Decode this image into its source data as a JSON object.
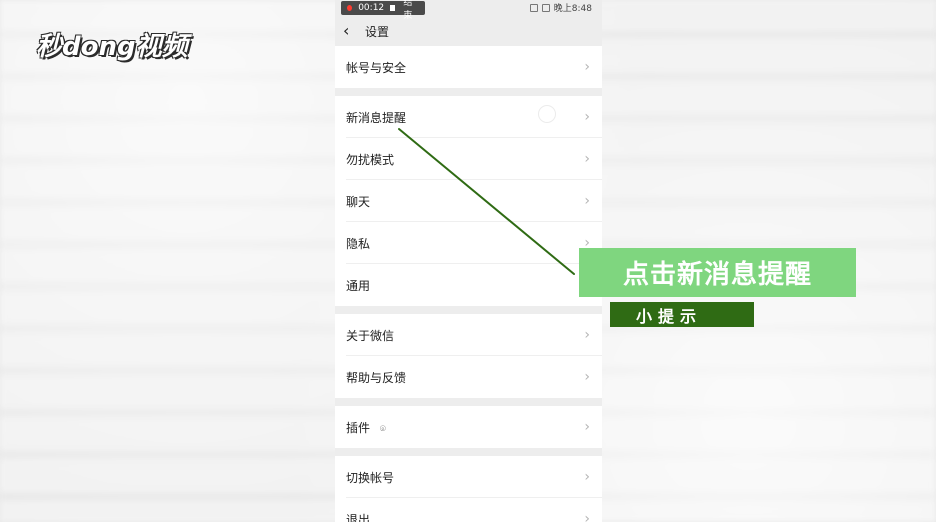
{
  "watermark": {
    "logo_text": "秒dong视频"
  },
  "status_bar": {
    "recording_time": "00:12",
    "recording_end": "结束",
    "clock_text": "晚上8:48",
    "icons": [
      "vibrate-icon",
      "battery-icon"
    ]
  },
  "navbar": {
    "back_icon": "chevron-left-icon",
    "title": "设置"
  },
  "settings": {
    "groups": [
      {
        "items": [
          {
            "label": "帐号与安全"
          }
        ]
      },
      {
        "items": [
          {
            "label": "新消息提醒"
          },
          {
            "label": "勿扰模式"
          },
          {
            "label": "聊天"
          },
          {
            "label": "隐私"
          },
          {
            "label": "通用"
          }
        ]
      },
      {
        "items": [
          {
            "label": "关于微信"
          },
          {
            "label": "帮助与反馈"
          }
        ]
      },
      {
        "items": [
          {
            "label": "插件",
            "icon": "location-pin-icon"
          }
        ]
      },
      {
        "items": [
          {
            "label": "切换帐号"
          },
          {
            "label": "退出"
          }
        ]
      }
    ]
  },
  "overlay": {
    "tip_main": "点击新消息提醒",
    "tip_small": "小提示",
    "colors": {
      "tip_green": "#7fd67f",
      "tip_dark": "#2f6b14",
      "arrow": "#2f6b14"
    }
  }
}
